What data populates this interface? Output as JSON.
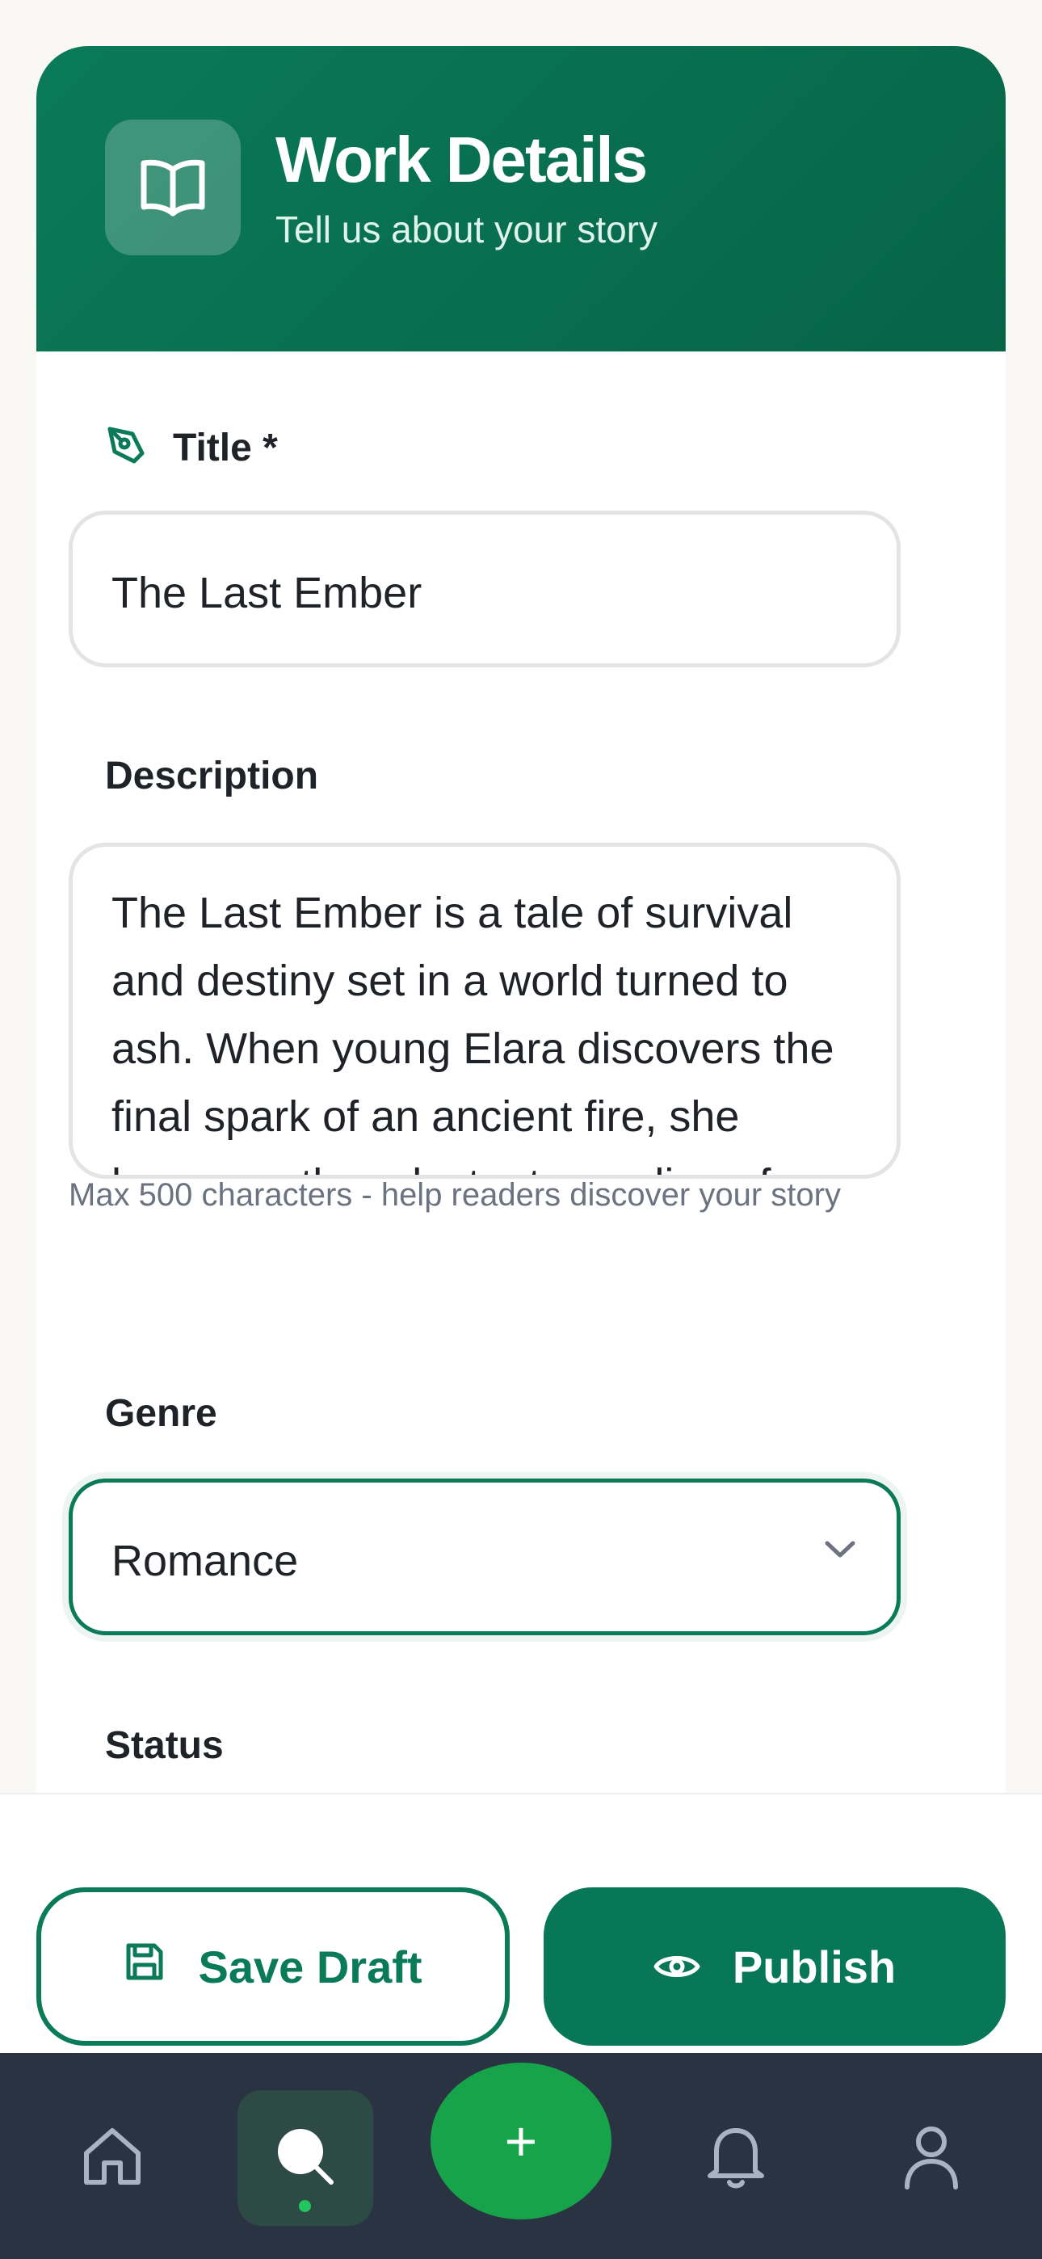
{
  "header": {
    "title": "Work Details",
    "subtitle": "Tell us about your story",
    "icon": "book-open-icon"
  },
  "form": {
    "title": {
      "label": "Title *",
      "icon": "pen-tool-icon",
      "value": "The Last Ember"
    },
    "description": {
      "label": "Description",
      "value": "The Last Ember is a tale of survival and destiny set in a world turned to ash. When young Elara discovers the final spark of an ancient fire, she becomes the reluctant guardian of",
      "hint": "Max 500 characters - help readers discover your story"
    },
    "genre": {
      "label": "Genre",
      "selected": "Romance"
    },
    "status": {
      "label": "Status"
    }
  },
  "actions": {
    "save_draft": "Save Draft",
    "publish": "Publish"
  },
  "nav": {
    "items": [
      "home-icon",
      "search-icon",
      "plus-icon",
      "bell-icon",
      "user-icon"
    ],
    "fab_label": "+",
    "active": "search"
  },
  "colors": {
    "primary": "#0a7a58",
    "fab": "#16a34a",
    "nav_bg": "#2a3342"
  }
}
